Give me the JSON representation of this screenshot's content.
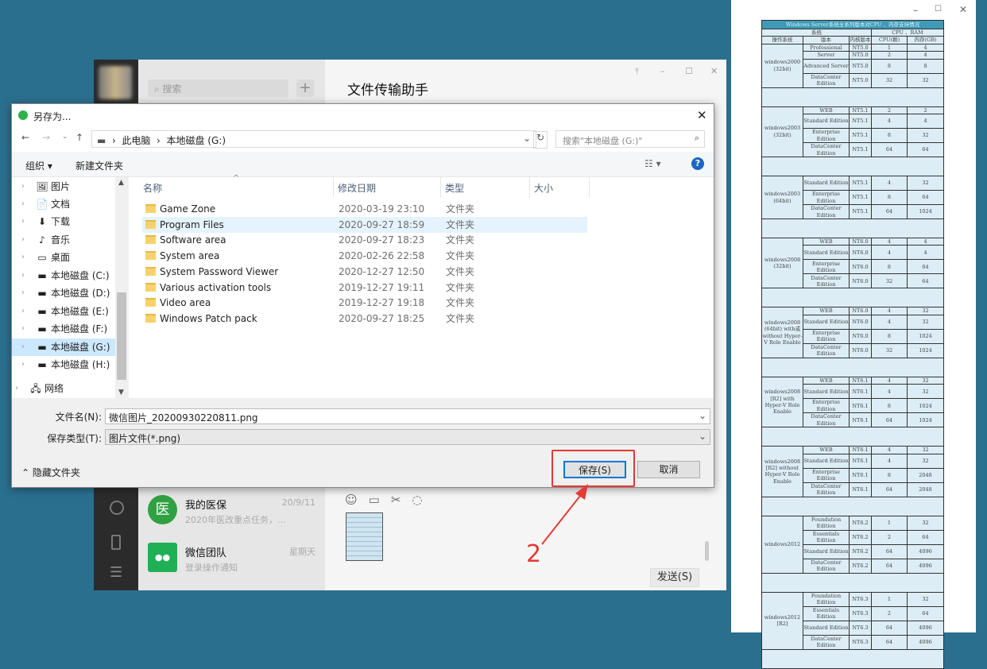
{
  "wechat": {
    "search_placeholder": "搜索",
    "plus": "+",
    "chat_title": "文件传输助手",
    "window_controls": [
      "⫯",
      "–",
      "☐",
      "✕"
    ],
    "chats": [
      {
        "name": "我的医保",
        "time": "20/9/11",
        "msg": "2020年医改重点任务，...",
        "avatar": "医",
        "color": "#2fa142"
      },
      {
        "name": "微信团队",
        "time": "星期天",
        "msg": "登录操作通知",
        "avatar": "●●",
        "color": "#1fb055"
      }
    ],
    "send_button": "发送(S)",
    "annotation": "2",
    "accent": "#e53935"
  },
  "dialog": {
    "title": "另存为...",
    "close": "✕",
    "breadcrumb": [
      "此电脑",
      "本地磁盘 (G:)"
    ],
    "search_placeholder": "搜索\"本地磁盘 (G:)\"",
    "organize": "组织 ▾",
    "new_folder": "新建文件夹",
    "tree": [
      {
        "label": "图片",
        "icon": "🖼"
      },
      {
        "label": "文档",
        "icon": "📄"
      },
      {
        "label": "下载",
        "icon": "⬇"
      },
      {
        "label": "音乐",
        "icon": "♪"
      },
      {
        "label": "桌面",
        "icon": "▭"
      },
      {
        "label": "本地磁盘 (C:)",
        "icon": "▬"
      },
      {
        "label": "本地磁盘 (D:)",
        "icon": "▬"
      },
      {
        "label": "本地磁盘 (E:)",
        "icon": "▬"
      },
      {
        "label": "本地磁盘 (F:)",
        "icon": "▬"
      },
      {
        "label": "本地磁盘 (G:)",
        "icon": "▬"
      },
      {
        "label": "本地磁盘 (H:)",
        "icon": "▬"
      },
      {
        "label": "网络",
        "icon": "🖧"
      }
    ],
    "columns": [
      "名称",
      "修改日期",
      "类型",
      "大小"
    ],
    "files": [
      {
        "name": "Game Zone",
        "date": "2020-03-19 23:10",
        "type": "文件夹"
      },
      {
        "name": "Program Files",
        "date": "2020-09-27 18:59",
        "type": "文件夹"
      },
      {
        "name": "Software area",
        "date": "2020-09-27 18:23",
        "type": "文件夹"
      },
      {
        "name": "System area",
        "date": "2020-02-26 22:58",
        "type": "文件夹"
      },
      {
        "name": "System Password Viewer",
        "date": "2020-12-27 12:50",
        "type": "文件夹"
      },
      {
        "name": "Various activation tools",
        "date": "2019-12-27 19:11",
        "type": "文件夹"
      },
      {
        "name": "Video area",
        "date": "2019-12-27 19:18",
        "type": "文件夹"
      },
      {
        "name": "Windows Patch pack",
        "date": "2020-09-27 18:25",
        "type": "文件夹"
      }
    ],
    "filename_label": "文件名(N):",
    "filename_value": "微信图片_20200930220811.png",
    "filetype_label": "保存类型(T):",
    "filetype_value": "图片文件(*.png)",
    "hide_folders": "隐藏文件夹",
    "save": "保存(S)",
    "cancel": "取消"
  },
  "doc_table": {
    "title": "Windows Server系统全系列版本对CPU 、内存支持情况",
    "header1": [
      "系统",
      "CPU 、RAM"
    ],
    "header2": [
      "操作系统",
      "版本",
      "内核版本",
      "CPU(颗)",
      "内存(GB)"
    ],
    "groups": [
      {
        "os": "windows2000 (32bit)",
        "rows": [
          [
            "Professional",
            "NT5.0",
            "1",
            "4"
          ],
          [
            "Server",
            "NT5.0",
            "2",
            "4"
          ],
          [
            "Advanced Server",
            "NT5.0",
            "8",
            "8"
          ],
          [
            "DataCenter Edition",
            "NT5.0",
            "32",
            "32"
          ]
        ]
      },
      {
        "os": "windows2003 (32bit)",
        "rows": [
          [
            "WEB",
            "NT5.1",
            "2",
            "2"
          ],
          [
            "Standard Edition",
            "NT5.1",
            "4",
            "4"
          ],
          [
            "Enterprise Edition",
            "NT5.1",
            "8",
            "32"
          ],
          [
            "DataCenter Edition",
            "NT5.1",
            "64",
            "64"
          ]
        ]
      },
      {
        "os": "windows2003 (64bit)",
        "rows": [
          [
            "Standard Edition",
            "NT5.1",
            "4",
            "32"
          ],
          [
            "Enterprise Edition",
            "NT5.1",
            "8",
            "64"
          ],
          [
            "DataCenter Edition",
            "NT5.1",
            "64",
            "1024"
          ]
        ]
      },
      {
        "os": "windows2008 (32bit)",
        "rows": [
          [
            "WEB",
            "NT6.0",
            "4",
            "4"
          ],
          [
            "Standard Edition",
            "NT6.0",
            "4",
            "4"
          ],
          [
            "Enterprise Edition",
            "NT6.0",
            "8",
            "64"
          ],
          [
            "DataCenter Edition",
            "NT6.0",
            "32",
            "64"
          ]
        ]
      },
      {
        "os": "windows2008 (64bit) with或without Hyper-V Role Enable",
        "rows": [
          [
            "WEB",
            "NT6.0",
            "4",
            "32"
          ],
          [
            "Standard Edition",
            "NT6.0",
            "4",
            "32"
          ],
          [
            "Enterprise Edition",
            "NT6.0",
            "8",
            "1024"
          ],
          [
            "DataCenter Edition",
            "NT6.0",
            "32",
            "1024"
          ]
        ]
      },
      {
        "os": "windows2008 [R2] with Hyper-V Role Enable",
        "rows": [
          [
            "WEB",
            "NT6.1",
            "4",
            "32"
          ],
          [
            "Standard Edition",
            "NT6.1",
            "4",
            "32"
          ],
          [
            "Enterprise Edition",
            "NT6.1",
            "8",
            "1024"
          ],
          [
            "DataCenter Edition",
            "NT6.1",
            "64",
            "1024"
          ]
        ]
      },
      {
        "os": "windows2008 [R2] without Hyper-V Role Enable",
        "rows": [
          [
            "WEB",
            "NT6.1",
            "4",
            "32"
          ],
          [
            "Standard Edition",
            "NT6.1",
            "4",
            "32"
          ],
          [
            "Enterprise Edition",
            "NT6.1",
            "8",
            "2048"
          ],
          [
            "DataCenter Edition",
            "NT6.1",
            "64",
            "2048"
          ]
        ]
      },
      {
        "os": "windows2012",
        "rows": [
          [
            "Foundation Edition",
            "NT6.2",
            "1",
            "32"
          ],
          [
            "Essentials Edition",
            "NT6.2",
            "2",
            "64"
          ],
          [
            "Standard Edition",
            "NT6.2",
            "64",
            "4096"
          ],
          [
            "DataCenter Edition",
            "NT6.2",
            "64",
            "4096"
          ]
        ]
      },
      {
        "os": "windows2012 [R2]",
        "rows": [
          [
            "Foundation Edition",
            "NT6.3",
            "1",
            "32"
          ],
          [
            "Essentials Edition",
            "NT6.3",
            "2",
            "64"
          ],
          [
            "Standard Edition",
            "NT6.3",
            "64",
            "4096"
          ],
          [
            "DataCenter Edition",
            "NT6.3",
            "64",
            "4096"
          ]
        ]
      }
    ]
  },
  "doc_window_controls": [
    "–",
    "☐",
    "✕"
  ]
}
